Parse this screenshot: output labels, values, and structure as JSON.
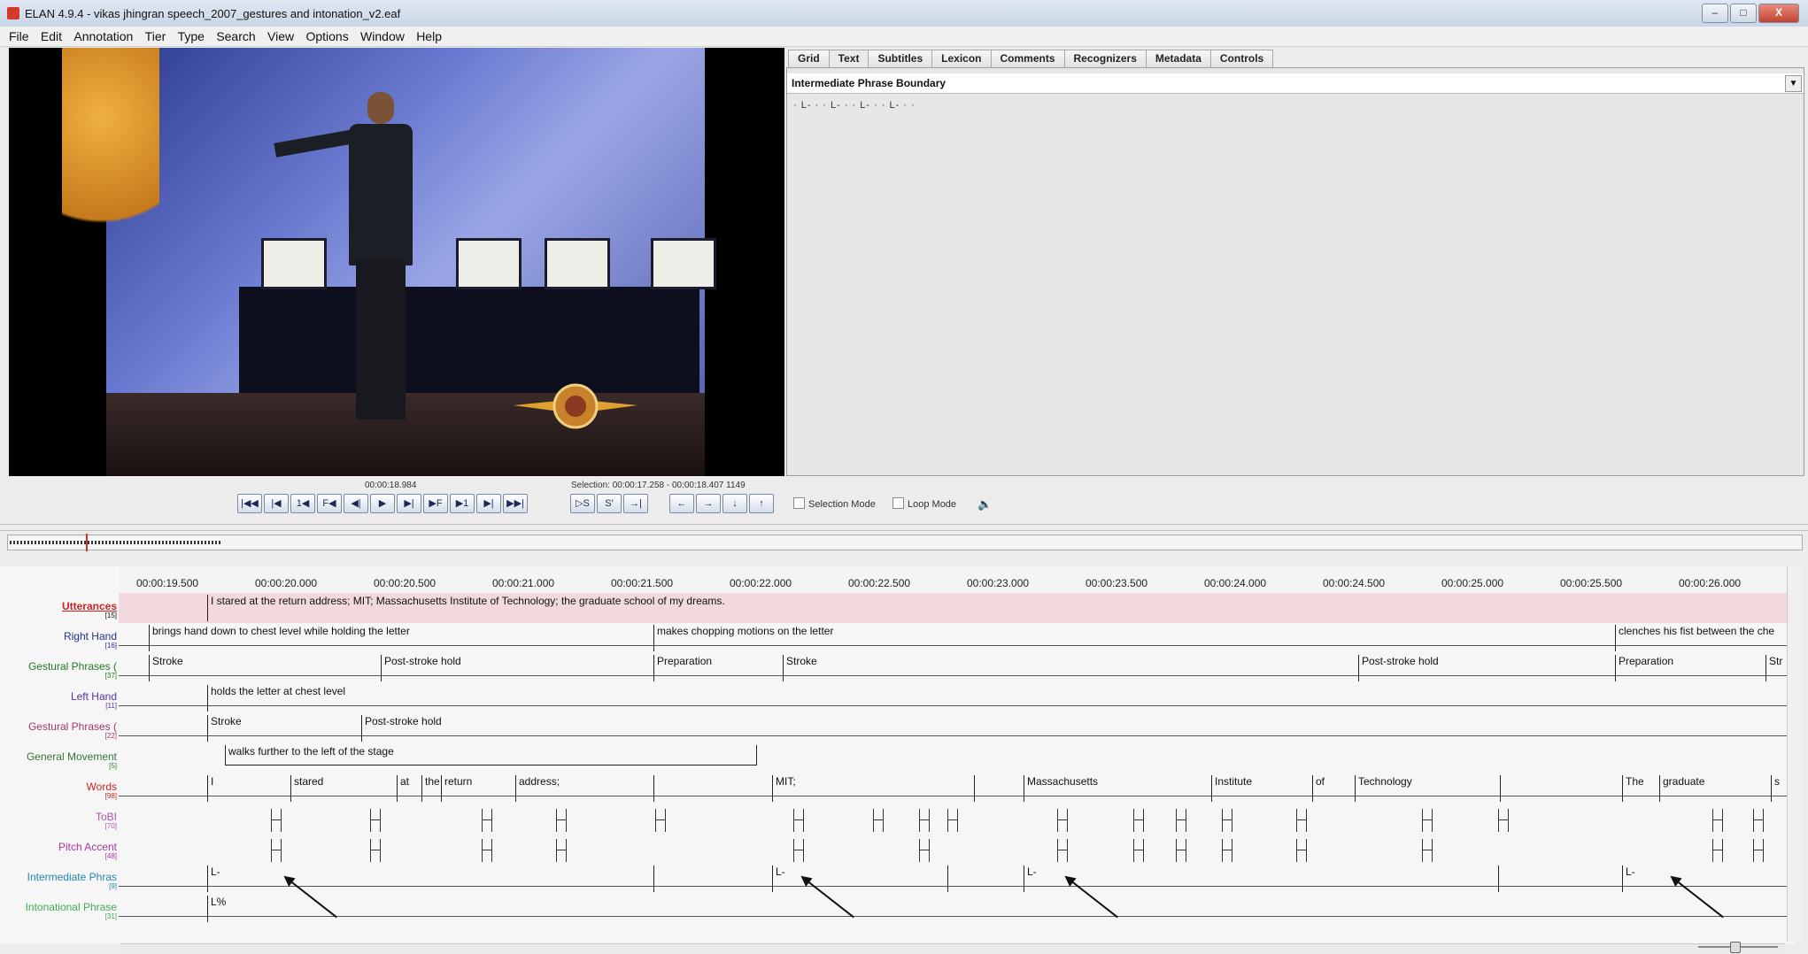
{
  "window": {
    "title": "ELAN 4.9.4 - vikas jhingran speech_2007_gestures and intonation_v2.eaf",
    "minimize": "–",
    "maximize": "□",
    "close": "X"
  },
  "menu": [
    "File",
    "Edit",
    "Annotation",
    "Tier",
    "Type",
    "Search",
    "View",
    "Options",
    "Window",
    "Help"
  ],
  "tabs": [
    "Grid",
    "Text",
    "Subtitles",
    "Lexicon",
    "Comments",
    "Recognizers",
    "Metadata",
    "Controls"
  ],
  "active_tab": "Text",
  "text_panel": {
    "tier": "Intermediate Phrase Boundary",
    "content": "· L- · · L- · · L- · · L- · ·"
  },
  "media": {
    "current_time": "00:00:18.984",
    "selection": "Selection: 00:00:17.258 - 00:00:18.407  1149"
  },
  "controls": {
    "buttons": [
      "|◀◀",
      "|◀",
      "1◀",
      "F◀",
      "◀|",
      "▶",
      "▶|",
      "▶F",
      "▶1",
      "▶|",
      "▶▶|",
      "▷S",
      "S′",
      "→|",
      "←",
      "→",
      "↓",
      "↑"
    ],
    "selection_mode": "Selection Mode",
    "loop_mode": "Loop Mode",
    "volume_icon": "🔈"
  },
  "ruler": [
    "00:00:19.500",
    "00:00:20.000",
    "00:00:20.500",
    "00:00:21.000",
    "00:00:21.500",
    "00:00:22.000",
    "00:00:22.500",
    "00:00:23.000",
    "00:00:23.500",
    "00:00:24.000",
    "00:00:24.500",
    "00:00:25.000",
    "00:00:25.500",
    "00:00:26.000"
  ],
  "tiers": [
    {
      "name": "Utterances",
      "count": "[15]",
      "color": "#cc2222",
      "annotations": [
        {
          "text": "I stared at the return address; MIT; Massachusetts Institute of Technology; the graduate school of my dreams."
        }
      ]
    },
    {
      "name": "Right Hand",
      "count": "[16]",
      "color": "#223388",
      "annotations": [
        {
          "text": "brings hand down to chest level while holding the letter"
        },
        {
          "text": "makes chopping motions on the letter"
        },
        {
          "text": "clenches his fist between the che"
        }
      ]
    },
    {
      "name": "Gestural Phrases (",
      "count": "[37]",
      "color": "#227722",
      "annotations": [
        {
          "text": "Stroke"
        },
        {
          "text": "Post-stroke hold"
        },
        {
          "text": "Preparation"
        },
        {
          "text": "Stroke"
        },
        {
          "text": "Post-stroke hold"
        },
        {
          "text": "Preparation"
        },
        {
          "text": "Str"
        }
      ]
    },
    {
      "name": "Left Hand",
      "count": "[11]",
      "color": "#5533aa",
      "annotations": [
        {
          "text": "holds the letter at chest level"
        }
      ]
    },
    {
      "name": "Gestural Phrases (",
      "count": "[22]",
      "color": "#aa3366",
      "annotations": [
        {
          "text": "Stroke"
        },
        {
          "text": "Post-stroke hold"
        }
      ]
    },
    {
      "name": "General Movement",
      "count": "[5]",
      "color": "#337733",
      "annotations": [
        {
          "text": "walks further to the left of the stage"
        }
      ]
    },
    {
      "name": "Words",
      "count": "[98]",
      "color": "#cc2222",
      "annotations": [
        {
          "text": "I"
        },
        {
          "text": "stared"
        },
        {
          "text": "at"
        },
        {
          "text": "the"
        },
        {
          "text": "return"
        },
        {
          "text": "address;"
        },
        {
          "text": "MIT;"
        },
        {
          "text": "Massachusetts"
        },
        {
          "text": "Institute"
        },
        {
          "text": "of"
        },
        {
          "text": "Technology"
        },
        {
          "text": "The"
        },
        {
          "text": "graduate"
        },
        {
          "text": "s"
        }
      ]
    },
    {
      "name": "ToBI",
      "count": "[70]",
      "color": "#aa55aa",
      "annotations": []
    },
    {
      "name": "Pitch Accent",
      "count": "[48]",
      "color": "#aa33aa",
      "annotations": []
    },
    {
      "name": "Intermediate Phras",
      "count": "[9]",
      "color": "#2288aa",
      "annotations": [
        {
          "text": "L-"
        },
        {
          "text": "L-"
        },
        {
          "text": "L-"
        },
        {
          "text": "L-"
        }
      ]
    },
    {
      "name": "Intonational Phrase",
      "count": "[31]",
      "color": "#44aa55",
      "annotations": [
        {
          "text": "L%"
        }
      ]
    }
  ]
}
